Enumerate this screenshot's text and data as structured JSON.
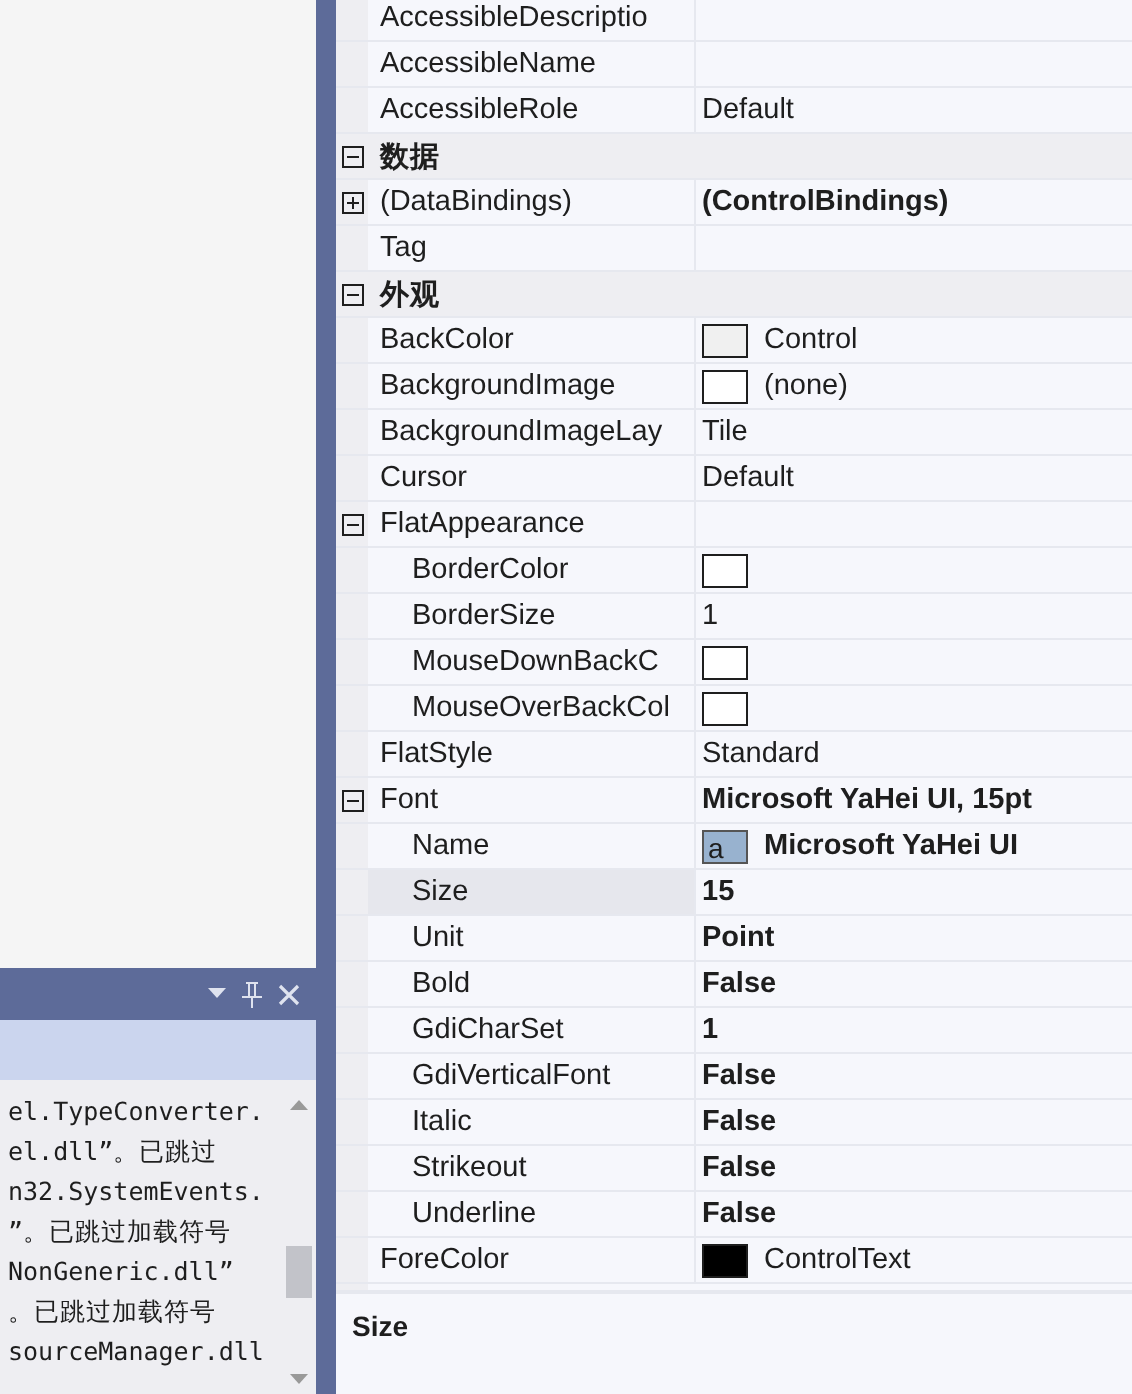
{
  "output_panel": {
    "lines": [
      "el.TypeConverter.",
      "el.dll”。已跳过",
      "n32.SystemEvents.",
      "”。已跳过加载符号",
      "NonGeneric.dll”",
      "。已跳过加载符号",
      "sourceManager.dll"
    ]
  },
  "property_grid": {
    "rows": [
      {
        "kind": "property",
        "name": "AccessibleDescriptio",
        "selected": false
      },
      {
        "kind": "property",
        "name": "AccessibleName",
        "selected": false
      },
      {
        "kind": "property",
        "name": "AccessibleRole",
        "value": "Default",
        "bold": false,
        "selected": false
      },
      {
        "kind": "category",
        "name": "数据",
        "expanded": true,
        "children": [
          {
            "kind": "property",
            "name": "(DataBindings)",
            "value": "(ControlBindings)",
            "bold": true,
            "expanded": false,
            "selected": false
          },
          {
            "kind": "property",
            "name": "Tag",
            "selected": false
          }
        ]
      },
      {
        "kind": "category",
        "name": "外观",
        "expanded": true,
        "children": [
          {
            "kind": "property",
            "name": "BackColor",
            "value": "Control",
            "bold": false,
            "swatch": {
              "kind": "color",
              "color": "#f0f0f0"
            },
            "selected": false
          },
          {
            "kind": "property",
            "name": "BackgroundImage",
            "value": "(none)",
            "bold": false,
            "swatch": {
              "kind": "color",
              "color": "#ffffff"
            },
            "selected": false
          },
          {
            "kind": "property",
            "name": "BackgroundImageLay",
            "value": "Tile",
            "bold": false,
            "selected": false
          },
          {
            "kind": "property",
            "name": "Cursor",
            "value": "Default",
            "bold": false,
            "selected": false
          },
          {
            "kind": "property",
            "name": "FlatAppearance",
            "expanded": true,
            "selected": false,
            "children": [
              {
                "kind": "property",
                "name": "BorderColor",
                "swatch": {
                  "kind": "color",
                  "color": "#ffffff"
                },
                "selected": false
              },
              {
                "kind": "property",
                "name": "BorderSize",
                "value": "1",
                "bold": false,
                "selected": false
              },
              {
                "kind": "property",
                "name": "MouseDownBackC",
                "swatch": {
                  "kind": "color",
                  "color": "#ffffff"
                },
                "selected": false
              },
              {
                "kind": "property",
                "name": "MouseOverBackCol",
                "swatch": {
                  "kind": "color",
                  "color": "#ffffff"
                },
                "selected": false
              }
            ]
          },
          {
            "kind": "property",
            "name": "FlatStyle",
            "value": "Standard",
            "bold": false,
            "selected": false
          },
          {
            "kind": "property",
            "name": "Font",
            "value": "Microsoft YaHei UI, 15pt",
            "bold": true,
            "expanded": true,
            "selected": false,
            "children": [
              {
                "kind": "property",
                "name": "Name",
                "value": "Microsoft YaHei UI",
                "bold": true,
                "swatch": {
                  "kind": "font",
                  "text": "a"
                },
                "selected": false
              },
              {
                "kind": "property",
                "name": "Size",
                "value": "15",
                "bold": true,
                "selected": true
              },
              {
                "kind": "property",
                "name": "Unit",
                "value": "Point",
                "bold": true,
                "selected": false
              },
              {
                "kind": "property",
                "name": "Bold",
                "value": "False",
                "bold": true,
                "selected": false
              },
              {
                "kind": "property",
                "name": "GdiCharSet",
                "value": "1",
                "bold": true,
                "selected": false
              },
              {
                "kind": "property",
                "name": "GdiVerticalFont",
                "value": "False",
                "bold": true,
                "selected": false
              },
              {
                "kind": "property",
                "name": "Italic",
                "value": "False",
                "bold": true,
                "selected": false
              },
              {
                "kind": "property",
                "name": "Strikeout",
                "value": "False",
                "bold": true,
                "selected": false
              },
              {
                "kind": "property",
                "name": "Underline",
                "value": "False",
                "bold": true,
                "selected": false
              }
            ]
          },
          {
            "kind": "property",
            "name": "ForeColor",
            "value": "ControlText",
            "bold": false,
            "swatch": {
              "kind": "color",
              "color": "#000000"
            },
            "selected": false
          }
        ]
      }
    ]
  },
  "description": {
    "title": "Size"
  }
}
